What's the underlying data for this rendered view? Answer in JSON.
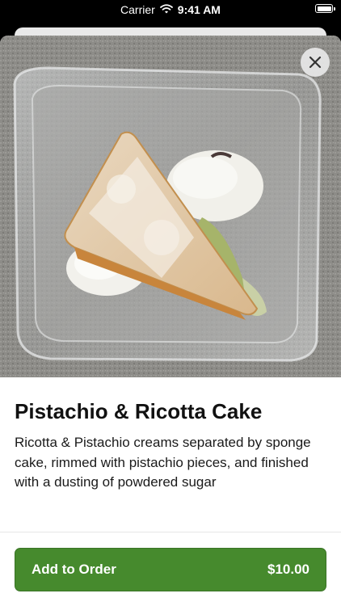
{
  "status_bar": {
    "carrier": "Carrier",
    "time": "9:41 AM"
  },
  "item": {
    "title": "Pistachio & Ricotta Cake",
    "description": "Ricotta & Pistachio creams separated by sponge cake, rimmed with pistachio pieces, and finished with a dusting of powdered sugar"
  },
  "order_button": {
    "label": "Add to Order",
    "price": "$10.00"
  },
  "icons": {
    "close": "close-icon",
    "wifi": "wifi-icon",
    "battery": "battery-icon"
  },
  "colors": {
    "button": "#468a2d",
    "photo_background": "#8b8a86"
  }
}
